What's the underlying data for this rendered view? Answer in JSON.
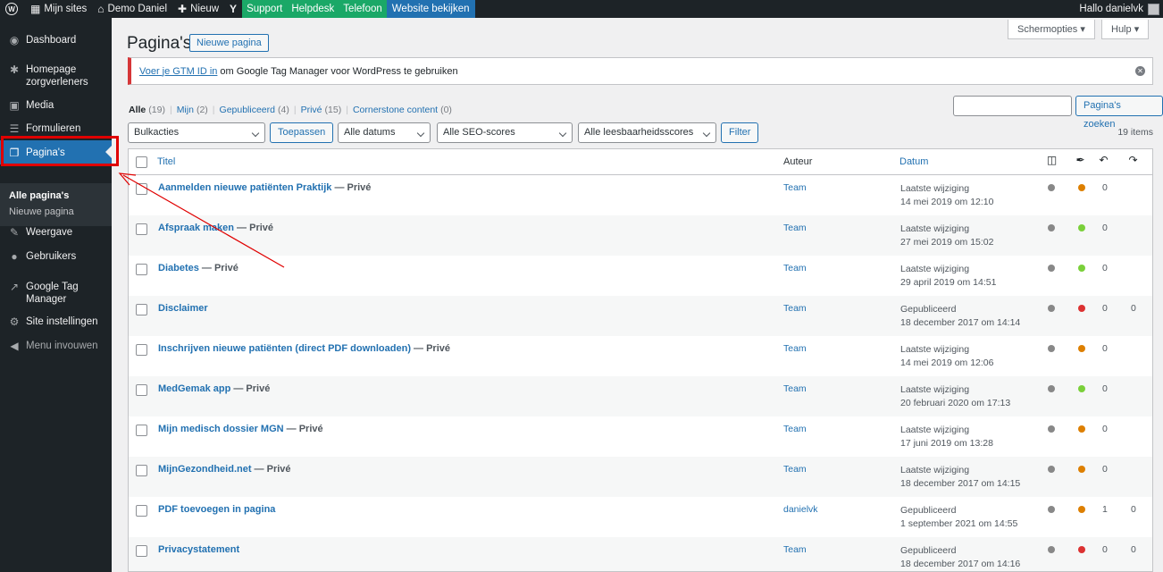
{
  "adminbar": {
    "wp_label": "W",
    "sites": "Mijn sites",
    "site_name": "Demo Daniel",
    "new": "Nieuw",
    "yoast": "Y",
    "support": "Support",
    "helpdesk": "Helpdesk",
    "phone": "Telefoon",
    "view_site": "Website bekijken",
    "greeting": "Hallo danielvk"
  },
  "sidebar": {
    "dashboard": "Dashboard",
    "homepage_line1": "Homepage",
    "homepage_line2": "zorgverleners",
    "media": "Media",
    "forms": "Formulieren",
    "pages": "Pagina's",
    "sub_all": "Alle pagina's",
    "sub_new": "Nieuwe pagina",
    "appearance": "Weergave",
    "users": "Gebruikers",
    "gtm_line1": "Google Tag",
    "gtm_line2": "Manager",
    "settings": "Site instellingen",
    "collapse": "Menu invouwen"
  },
  "header": {
    "title": "Pagina's",
    "new_button": "Nieuwe pagina",
    "screen_options": "Schermopties",
    "help": "Hulp"
  },
  "notice": {
    "link": "Voer je GTM ID in",
    "text": "om Google Tag Manager voor WordPress te gebruiken"
  },
  "filters": {
    "all": "Alle",
    "all_count": "(19)",
    "mine": "Mijn",
    "mine_count": "(2)",
    "published": "Gepubliceerd",
    "published_count": "(4)",
    "private": "Privé",
    "private_count": "(15)",
    "cornerstone": "Cornerstone content",
    "cornerstone_count": "(0)"
  },
  "search": {
    "placeholder": "",
    "button": "Pagina's zoeken"
  },
  "toolbar": {
    "bulk": "Bulkacties",
    "apply": "Toepassen",
    "dates": "Alle datums",
    "seo": "Alle SEO-scores",
    "readability": "Alle leesbaarheidsscores",
    "filter": "Filter",
    "count": "19 items"
  },
  "table": {
    "columns": {
      "title": "Titel",
      "author": "Auteur",
      "date": "Datum"
    },
    "rows": [
      {
        "title": "Aanmelden nieuwe patiënten Praktijk",
        "state": " — Privé",
        "author": "Team",
        "status": "Laatste wijziging",
        "date": "14 mei 2019 om 12:10",
        "readability": "#dd7f00",
        "links": "0",
        "incoming": ""
      },
      {
        "title": "Afspraak maken",
        "state": " — Privé",
        "author": "Team",
        "status": "Laatste wijziging",
        "date": "27 mei 2019 om 15:02",
        "readability": "#7ad03a",
        "links": "0",
        "incoming": ""
      },
      {
        "title": "Diabetes",
        "state": " — Privé",
        "author": "Team",
        "status": "Laatste wijziging",
        "date": "29 april 2019 om 14:51",
        "readability": "#7ad03a",
        "links": "0",
        "incoming": ""
      },
      {
        "title": "Disclaimer",
        "state": "",
        "author": "Team",
        "status": "Gepubliceerd",
        "date": "18 december 2017 om 14:14",
        "readability": "#dc3232",
        "links": "0",
        "incoming": "0"
      },
      {
        "title": "Inschrijven nieuwe patiënten (direct PDF downloaden)",
        "state": " — Privé",
        "author": "Team",
        "status": "Laatste wijziging",
        "date": "14 mei 2019 om 12:06",
        "readability": "#dd7f00",
        "links": "0",
        "incoming": ""
      },
      {
        "title": "MedGemak app",
        "state": " — Privé",
        "author": "Team",
        "status": "Laatste wijziging",
        "date": "20 februari 2020 om 17:13",
        "readability": "#7ad03a",
        "links": "0",
        "incoming": ""
      },
      {
        "title": "Mijn medisch dossier MGN",
        "state": " — Privé",
        "author": "Team",
        "status": "Laatste wijziging",
        "date": "17 juni 2019 om 13:28",
        "readability": "#dd7f00",
        "links": "0",
        "incoming": ""
      },
      {
        "title": "MijnGezondheid.net",
        "state": " — Privé",
        "author": "Team",
        "status": "Laatste wijziging",
        "date": "18 december 2017 om 14:15",
        "readability": "#dd7f00",
        "links": "0",
        "incoming": ""
      },
      {
        "title": "PDF toevoegen in pagina",
        "state": "",
        "author": "danielvk",
        "status": "Gepubliceerd",
        "date": "1 september 2021 om 14:55",
        "readability": "#dd7f00",
        "links": "1",
        "incoming": "0"
      },
      {
        "title": "Privacystatement",
        "state": "",
        "author": "Team",
        "status": "Gepubliceerd",
        "date": "18 december 2017 om 14:16",
        "readability": "#dc3232",
        "links": "0",
        "incoming": "0"
      }
    ]
  }
}
